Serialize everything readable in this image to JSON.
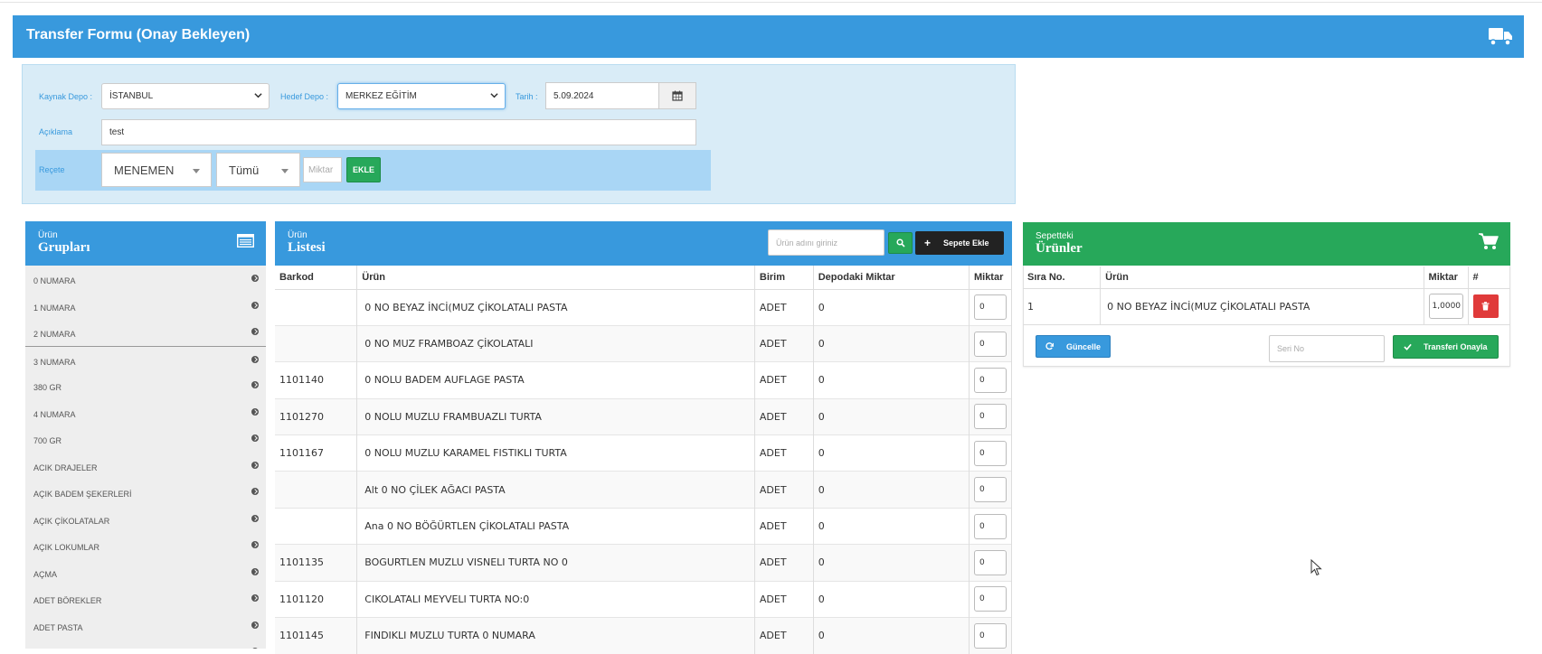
{
  "page_title": "Transfer Formu (Onay Bekleyen)",
  "form": {
    "kaynak_label": "Kaynak Depo :",
    "kaynak_value": "İSTANBUL",
    "hedef_label": "Hedef Depo :",
    "hedef_value": "MERKEZ EĞİTİM",
    "tarih_label": "Tarih :",
    "tarih_value": "5.09.2024",
    "aciklama_label": "Açıklama",
    "aciklama_value": "test",
    "recete_label": "Reçete",
    "recete_value": "MENEMEN",
    "filter_value": "Tümü",
    "miktar_placeholder": "Miktar",
    "ekle_label": "EKLE"
  },
  "groups": {
    "small": "Ürün",
    "big": "Grupları",
    "items": [
      "0 NUMARA",
      "1 NUMARA",
      "2 NUMARA",
      "3 NUMARA",
      "380 GR",
      "4 NUMARA",
      "700 GR",
      "ACIK DRAJELER",
      "AÇIK BADEM ŞEKERLERİ",
      "AÇIK ÇİKOLATALAR",
      "AÇIK LOKUMLAR",
      "AÇMA",
      "ADET BÖREKLER",
      "ADET PASTA",
      ""
    ]
  },
  "products": {
    "small": "Ürün",
    "big": "Listesi",
    "search_placeholder": "Ürün adını giriniz",
    "add_to_cart_label": "Sepete Ekle",
    "columns": [
      "Barkod",
      "Ürün",
      "Birim",
      "Depodaki Miktar",
      "Miktar"
    ],
    "rows": [
      {
        "barkod": "",
        "urun": "0 NO BEYAZ İNCİ(MUZ ÇİKOLATALI PASTA",
        "birim": "ADET",
        "depo": "0",
        "miktar": "0"
      },
      {
        "barkod": "",
        "urun": "0 NO MUZ FRAMBOAZ ÇİKOLATALI",
        "birim": "ADET",
        "depo": "0",
        "miktar": "0"
      },
      {
        "barkod": "1101140",
        "urun": "0 NOLU BADEM AUFLAGE PASTA",
        "birim": "ADET",
        "depo": "0",
        "miktar": "0"
      },
      {
        "barkod": "1101270",
        "urun": "0 NOLU MUZLU FRAMBUAZLI TURTA",
        "birim": "ADET",
        "depo": "0",
        "miktar": "0"
      },
      {
        "barkod": "1101167",
        "urun": "0 NOLU MUZLU KARAMEL FISTIKLI TURTA",
        "birim": "ADET",
        "depo": "0",
        "miktar": "0"
      },
      {
        "barkod": "",
        "urun": "Alt 0 NO ÇİLEK AĞACI PASTA",
        "birim": "ADET",
        "depo": "0",
        "miktar": "0"
      },
      {
        "barkod": "",
        "urun": "Ana 0 NO BÖĞÜRTLEN ÇİKOLATALI PASTA",
        "birim": "ADET",
        "depo": "0",
        "miktar": "0"
      },
      {
        "barkod": "1101135",
        "urun": "BOGURTLEN MUZLU VISNELI TURTA NO 0",
        "birim": "ADET",
        "depo": "0",
        "miktar": "0"
      },
      {
        "barkod": "1101120",
        "urun": "CIKOLATALI MEYVELI TURTA NO:0",
        "birim": "ADET",
        "depo": "0",
        "miktar": "0"
      },
      {
        "barkod": "1101145",
        "urun": "FINDIKLI MUZLU TURTA 0 NUMARA",
        "birim": "ADET",
        "depo": "0",
        "miktar": "0"
      }
    ]
  },
  "cart": {
    "small": "Sepetteki",
    "big": "Ürünler",
    "columns": [
      "Sıra No.",
      "Ürün",
      "Miktar",
      "#"
    ],
    "rows": [
      {
        "sira": "1",
        "urun": "0 NO BEYAZ İNCİ(MUZ ÇİKOLATALI PASTA",
        "miktar": "1,0000"
      }
    ],
    "update_label": "Güncelle",
    "seri_placeholder": "Seri No",
    "confirm_label": "Transferi Onayla"
  },
  "colors": {
    "primary": "#3899dd",
    "success": "#27a85a",
    "danger": "#e03a3a",
    "dark": "#222222"
  }
}
